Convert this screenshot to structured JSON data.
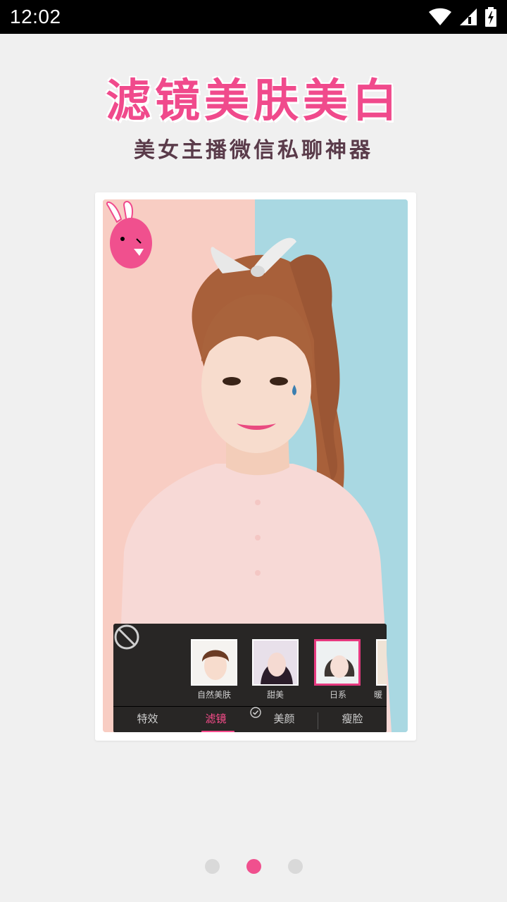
{
  "status_bar": {
    "time": "12:02",
    "icons": [
      "wifi-icon",
      "signal-icon",
      "battery-charging-icon"
    ]
  },
  "headline": "滤镜美肤美白",
  "subheadline": "美女主播微信私聊神器",
  "filter_panel": {
    "none_icon": "none-filter-icon",
    "filters": [
      {
        "label": "自然美肤",
        "selected": false
      },
      {
        "label": "甜美",
        "selected": false
      },
      {
        "label": "日系",
        "selected": true
      },
      {
        "label": "暖",
        "selected": false
      }
    ],
    "tabs": [
      {
        "label": "特效",
        "active": false
      },
      {
        "label": "滤镜",
        "active": true
      },
      {
        "label": "美颜",
        "active": false
      },
      {
        "label": "瘦脸",
        "active": false
      }
    ]
  },
  "pager": {
    "count": 3,
    "active_index": 1
  },
  "colors": {
    "accent": "#f0508e",
    "headline": "#f04a8c",
    "subheadline": "#5a3b4a",
    "background": "#f0f0f0"
  }
}
